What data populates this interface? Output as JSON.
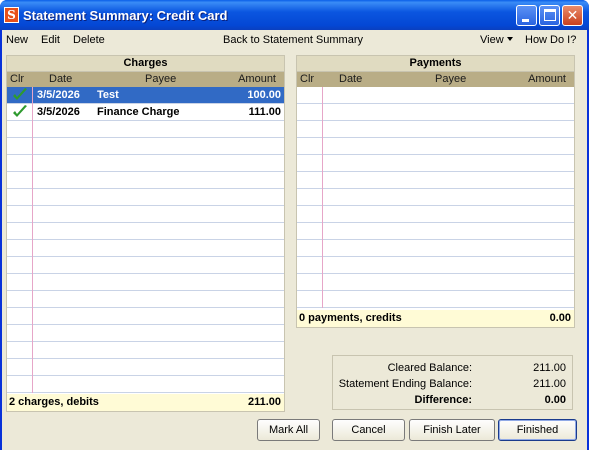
{
  "window": {
    "title": "Statement Summary: Credit Card",
    "app_icon_letter": "S"
  },
  "menu": {
    "new": "New",
    "edit": "Edit",
    "delete": "Delete",
    "back": "Back to Statement Summary",
    "view": "View",
    "how_do_i": "How Do I?"
  },
  "charges": {
    "title": "Charges",
    "columns": {
      "clr": "Clr",
      "date": "Date",
      "payee": "Payee",
      "amount": "Amount"
    },
    "rows": [
      {
        "cleared": true,
        "date": "3/5/2026",
        "payee": "Test",
        "amount": "100.00",
        "selected": true
      },
      {
        "cleared": true,
        "date": "3/5/2026",
        "payee": "Finance Charge",
        "amount": "111.00",
        "selected": false
      }
    ],
    "total_label": "2 charges, debits",
    "total_value": "211.00"
  },
  "payments": {
    "title": "Payments",
    "columns": {
      "clr": "Clr",
      "date": "Date",
      "payee": "Payee",
      "amount": "Amount"
    },
    "rows": [],
    "total_label": "0 payments, credits",
    "total_value": "0.00"
  },
  "balance": {
    "cleared_label": "Cleared Balance:",
    "cleared_value": "211.00",
    "ending_label": "Statement Ending Balance:",
    "ending_value": "211.00",
    "difference_label": "Difference:",
    "difference_value": "0.00"
  },
  "buttons": {
    "mark_all": "Mark All",
    "cancel": "Cancel",
    "finish_later": "Finish Later",
    "finished": "Finished"
  },
  "colors": {
    "selected_row": "#316ac5",
    "check": "#2e9a2e",
    "total_bg": "#fffbd6",
    "column_header": "#b9ad86"
  }
}
